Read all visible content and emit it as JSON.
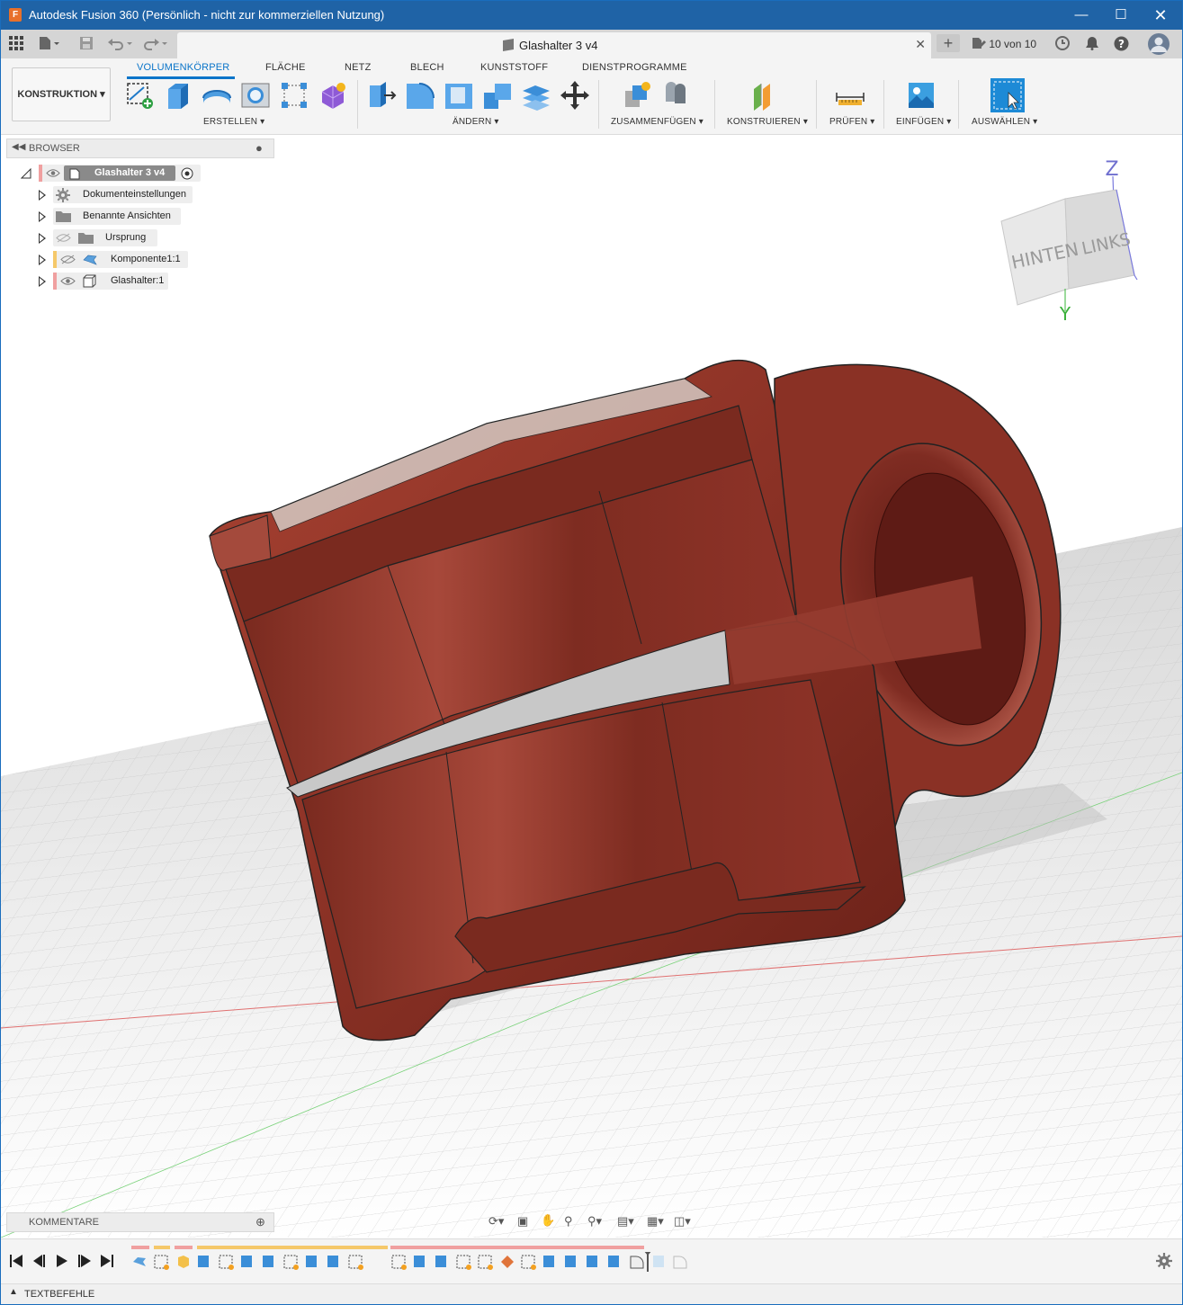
{
  "window": {
    "title": "Autodesk Fusion 360 (Persönlich - nicht zur kommerziellen Nutzung)",
    "app_icon": "fusion-icon",
    "controls": [
      "minimize",
      "maximize",
      "close"
    ]
  },
  "tabbar": {
    "document_tab": "Glashalter 3 v4",
    "versions": "10 von 10"
  },
  "toolbar": {
    "workspace": "KONSTRUKTION",
    "tabs": [
      "VOLUMENKÖRPER",
      "FLÄCHE",
      "NETZ",
      "BLECH",
      "KUNSTSTOFF",
      "DIENSTPROGRAMME"
    ],
    "active_tab": "VOLUMENKÖRPER",
    "groups": {
      "erstellen": "ERSTELLEN",
      "aendern": "ÄNDERN",
      "zusammen": "ZUSAMMENFÜGEN",
      "konstruieren": "KONSTRUIEREN",
      "pruefen": "PRÜFEN",
      "einfuegen": "EINFÜGEN",
      "auswaehlen": "AUSWÄHLEN"
    },
    "accent": "#0a74c9"
  },
  "browser": {
    "header": "BROWSER",
    "root": "Glashalter 3 v4",
    "items": [
      {
        "label": "Dokumenteinstellungen",
        "icon": "gear-icon"
      },
      {
        "label": "Benannte Ansichten",
        "icon": "folder-icon"
      },
      {
        "label": "Ursprung",
        "icon": "folder-icon"
      },
      {
        "label": "Komponente1:1",
        "icon": "component-icon"
      },
      {
        "label": "Glashalter:1",
        "icon": "body-icon"
      }
    ]
  },
  "viewcube": {
    "face_back": "HINTEN",
    "face_left": "LINKS",
    "axis_z": "Z",
    "axis_y": "Y"
  },
  "comments": {
    "header": "KOMMENTARE"
  },
  "commandbar": {
    "label": "TEXTBEFEHLE"
  },
  "model": {
    "color": "#8e3328",
    "name": "Glashalter"
  }
}
